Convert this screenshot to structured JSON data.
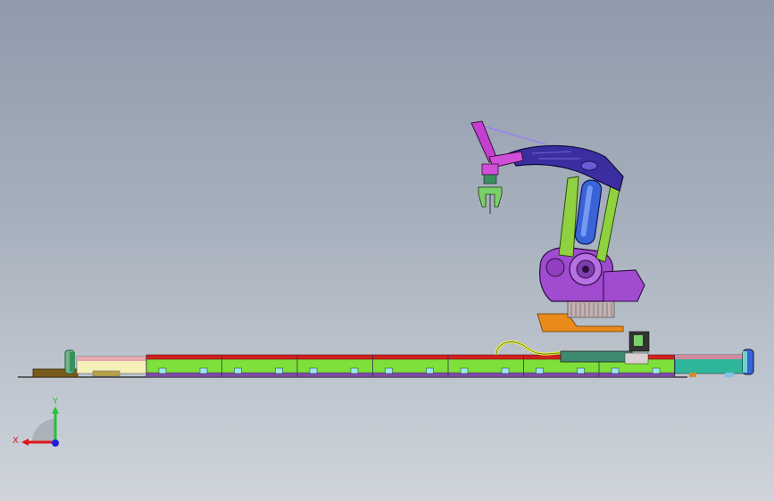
{
  "viewport": {
    "background_top": "#8f9aab",
    "background_bottom": "#cfd4db"
  },
  "model": {
    "robot_arm_color": "#3a2ea0",
    "robot_base_color": "#a04bd0",
    "link_color": "#8fd13f",
    "cylinder_color": "#3a63d8",
    "rail_color": "#7ee03a",
    "rail_stripe_color": "#d0211f",
    "end_cap_color": "#2fb59a"
  },
  "triad": {
    "x_label": "X",
    "y_label": "Y",
    "x_color": "#e0161a",
    "y_color": "#22c23a",
    "z_color": "#1e1ed8"
  }
}
